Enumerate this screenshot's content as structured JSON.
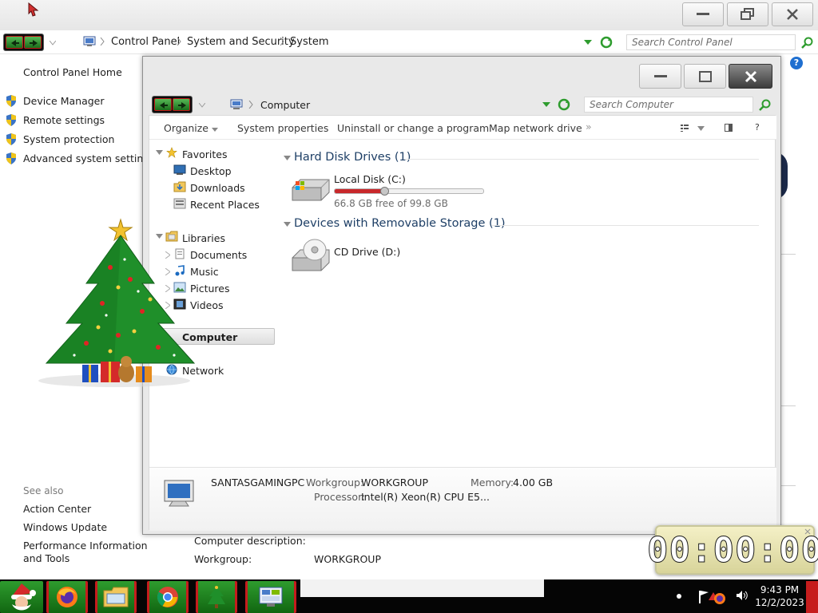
{
  "control_panel": {
    "breadcrumbs": [
      "Control Panel",
      "System and Security",
      "System"
    ],
    "search_placeholder": "Search Control Panel",
    "sidebar": {
      "home": "Control Panel Home",
      "links": [
        "Device Manager",
        "Remote settings",
        "System protection",
        "Advanced system settings"
      ],
      "see_also": "See also",
      "see_also_links": [
        "Action Center",
        "Windows Update",
        "Performance Information and Tools"
      ]
    },
    "computer_description_label": "Computer description:",
    "workgroup_label": "Workgroup:",
    "workgroup_value": "WORKGROUP",
    "help_label": "?"
  },
  "explorer": {
    "address": "Computer",
    "search_placeholder": "Search Computer",
    "toolbar": {
      "organize": "Organize",
      "system_properties": "System properties",
      "uninstall": "Uninstall or change a program",
      "map_drive": "Map network drive",
      "more": "»",
      "help": "?"
    },
    "nav": {
      "favorites": "Favorites",
      "favorites_items": [
        "Desktop",
        "Downloads",
        "Recent Places"
      ],
      "libraries": "Libraries",
      "libraries_items": [
        "Documents",
        "Music",
        "Pictures",
        "Videos"
      ],
      "computer": "Computer",
      "network": "Network"
    },
    "groups": {
      "hdd": "Hard Disk Drives (1)",
      "removable": "Devices with Removable Storage (1)"
    },
    "drives": {
      "local_name": "Local Disk (C:)",
      "local_free": "66.8 GB free of 99.8 GB",
      "local_used_fraction": 0.331,
      "cd_name": "CD Drive (D:)"
    },
    "details": {
      "name": "SANTASGAMINGPC",
      "workgroup_label": "Workgroup:",
      "workgroup": "WORKGROUP",
      "memory_label": "Memory:",
      "memory": "4.00 GB",
      "processor_label": "Processor:",
      "processor": "Intel(R) Xeon(R) CPU E5..."
    }
  },
  "clock": {
    "display": "00:00:00"
  },
  "taskbar": {
    "time": "9:43 PM",
    "date": "12/2/2023",
    "apps": [
      "santa-start-icon",
      "firefox-icon",
      "file-explorer-icon",
      "chrome-icon",
      "christmas-tree-icon",
      "control-panel-icon"
    ]
  },
  "colors": {
    "drive_bar": "#c8282b",
    "link": "#1e1e1e",
    "group_header": "#1e3f66",
    "nav_green": "#2e9c2e"
  }
}
